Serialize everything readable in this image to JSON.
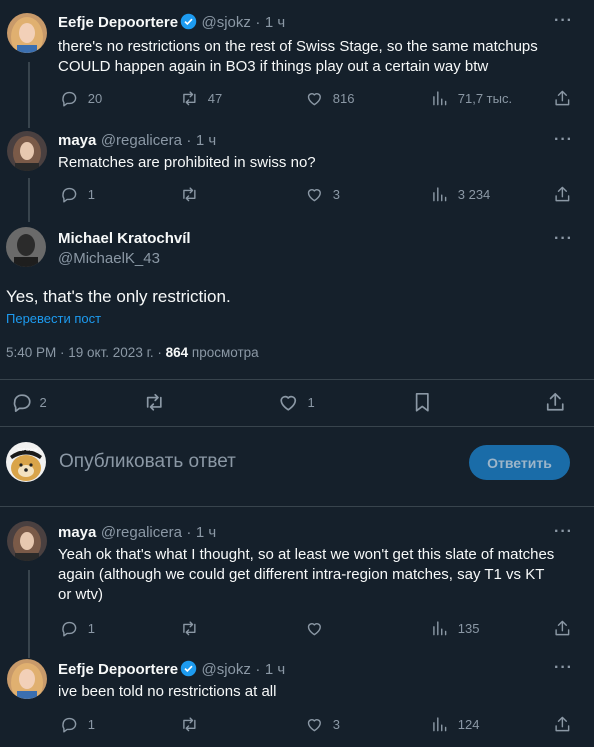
{
  "colors": {
    "background": "#15202b",
    "accent": "#1d9bf0",
    "muted": "#8b98a5",
    "divider": "#38444d"
  },
  "tweet1": {
    "name": "Eefje Depoortere",
    "handle": "@sjokz",
    "time": "1 ч",
    "text_line1": "there's no restrictions on the rest of Swiss Stage, so the same matchups",
    "text_line2": "COULD happen again in BO3 if things play out a certain way btw",
    "replies": "20",
    "retweets": "47",
    "likes": "816",
    "views": "71,7 тыс."
  },
  "tweet2": {
    "name": "maya",
    "handle": "@regalicera",
    "time": "1 ч",
    "text": "Rematches are prohibited in swiss no?",
    "replies": "1",
    "retweets": "",
    "likes": "3",
    "views": "3 234"
  },
  "main": {
    "name": "Michael Kratochvíl",
    "handle": "@MichaelK_43",
    "text": "Yes, that's the only restriction.",
    "translate": "Перевести пост",
    "timestamp": "5:40 PM · 19 окт. 2023 г. ·",
    "views_count": "864",
    "views_label": "просмотра",
    "replies": "2",
    "likes": "1"
  },
  "compose": {
    "avatar_text": "TOP DOGE",
    "placeholder": "Опубликовать ответ",
    "button": "Ответить"
  },
  "reply1": {
    "name": "maya",
    "handle": "@regalicera",
    "time": "1 ч",
    "text_line1": "Yeah ok that's what I thought, so at least we won't get this slate of matches",
    "text_line2": "again (although we could get different intra-region matches, say T1 vs KT",
    "text_line3": "or wtv)",
    "replies": "1",
    "likes": "",
    "views": "135"
  },
  "reply2": {
    "name": "Eefje Depoortere",
    "handle": "@sjokz",
    "time": "1 ч",
    "text": "ive been told no restrictions at all",
    "replies": "1",
    "likes": "3",
    "views": "124"
  },
  "dot": "·",
  "more": "···"
}
